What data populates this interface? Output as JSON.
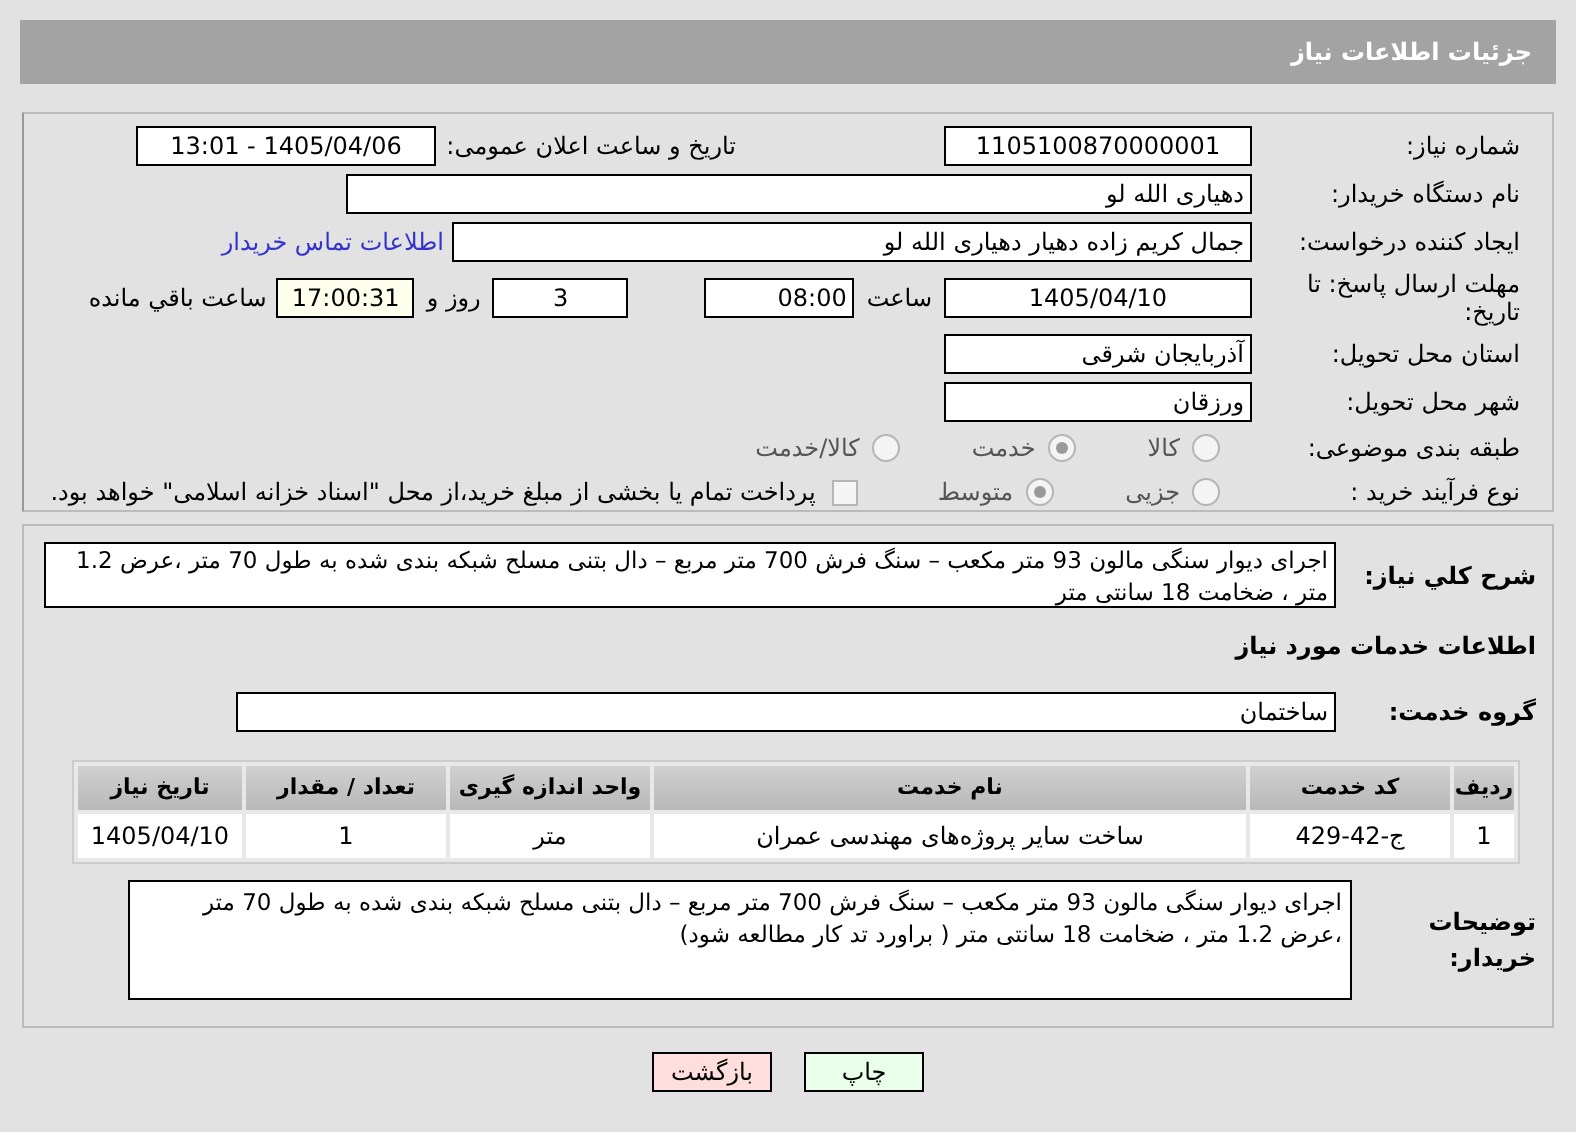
{
  "header": {
    "title": "جزئیات اطلاعات نیاز"
  },
  "need_number": {
    "label": "شماره نیاز:",
    "value": "1105100870000001"
  },
  "announce": {
    "label": "تاریخ و ساعت اعلان عمومی:",
    "value": "1405/04/06 - 13:01"
  },
  "buyer_org": {
    "label": "نام دستگاه خریدار:",
    "value": "دهیاری الله لو"
  },
  "requester": {
    "label": "ایجاد کننده درخواست:",
    "value": "جمال کریم زاده دهیار دهیاری الله لو",
    "link": "اطلاعات تماس خریدار"
  },
  "deadline": {
    "label": "مهلت ارسال پاسخ: تا تاریخ:",
    "date": "1405/04/10",
    "time_label": "ساعت",
    "time": "08:00",
    "days": "3",
    "days_label": "روز و",
    "remaining": "17:00:31",
    "remaining_label": "ساعت باقي مانده"
  },
  "province": {
    "label": "استان محل تحویل:",
    "value": "آذربایجان شرقی"
  },
  "city": {
    "label": "شهر محل تحویل:",
    "value": "ورزقان"
  },
  "category": {
    "label": "طبقه بندی موضوعی:",
    "options": [
      {
        "label": "کالا",
        "selected": false
      },
      {
        "label": "خدمت",
        "selected": true
      },
      {
        "label": "کالا/خدمت",
        "selected": false
      }
    ]
  },
  "process": {
    "label": "نوع فرآیند خرید :",
    "options": [
      {
        "label": "جزیی",
        "selected": false
      },
      {
        "label": "متوسط",
        "selected": true
      }
    ],
    "payment": {
      "label": "پرداخت تمام یا بخشی از مبلغ خرید،از محل \"اسناد خزانه اسلامی\" خواهد بود.",
      "checked": false
    }
  },
  "summary": {
    "label": "شرح کلي نیاز:",
    "value": "اجرای دیوار سنگی مالون  93 متر مکعب – سنگ فرش 700 متر مربع – دال بتنی مسلح شبکه بندی شده  به طول 70 متر ،عرض 1.2 متر ، ضخامت 18 سانتی متر"
  },
  "services_heading": "اطلاعات خدمات مورد نیاز",
  "service_group": {
    "label": "گروه خدمت:",
    "value": "ساختمان"
  },
  "table": {
    "columns": [
      "ردیف",
      "کد خدمت",
      "نام خدمت",
      "واحد اندازه گیری",
      "تعداد / مقدار",
      "تاریخ نیاز"
    ],
    "rows": [
      [
        "1",
        "ج-42-429",
        "ساخت سایر پروژه‌های مهندسی عمران",
        "متر",
        "1",
        "1405/04/10"
      ]
    ]
  },
  "buyer_notes": {
    "label": "توضیحات خریدار:",
    "value": "اجرای دیوار سنگی مالون  93 متر مکعب – سنگ فرش 700 متر مربع – دال بتنی مسلح شبکه بندی شده  به طول 70 متر ،عرض 1.2 متر ، ضخامت 18 سانتی متر  ( براورد تد کار مطالعه شود)"
  },
  "buttons": [
    {
      "label": "چاپ",
      "kind": "print"
    },
    {
      "label": "بازگشت",
      "kind": "back"
    }
  ]
}
